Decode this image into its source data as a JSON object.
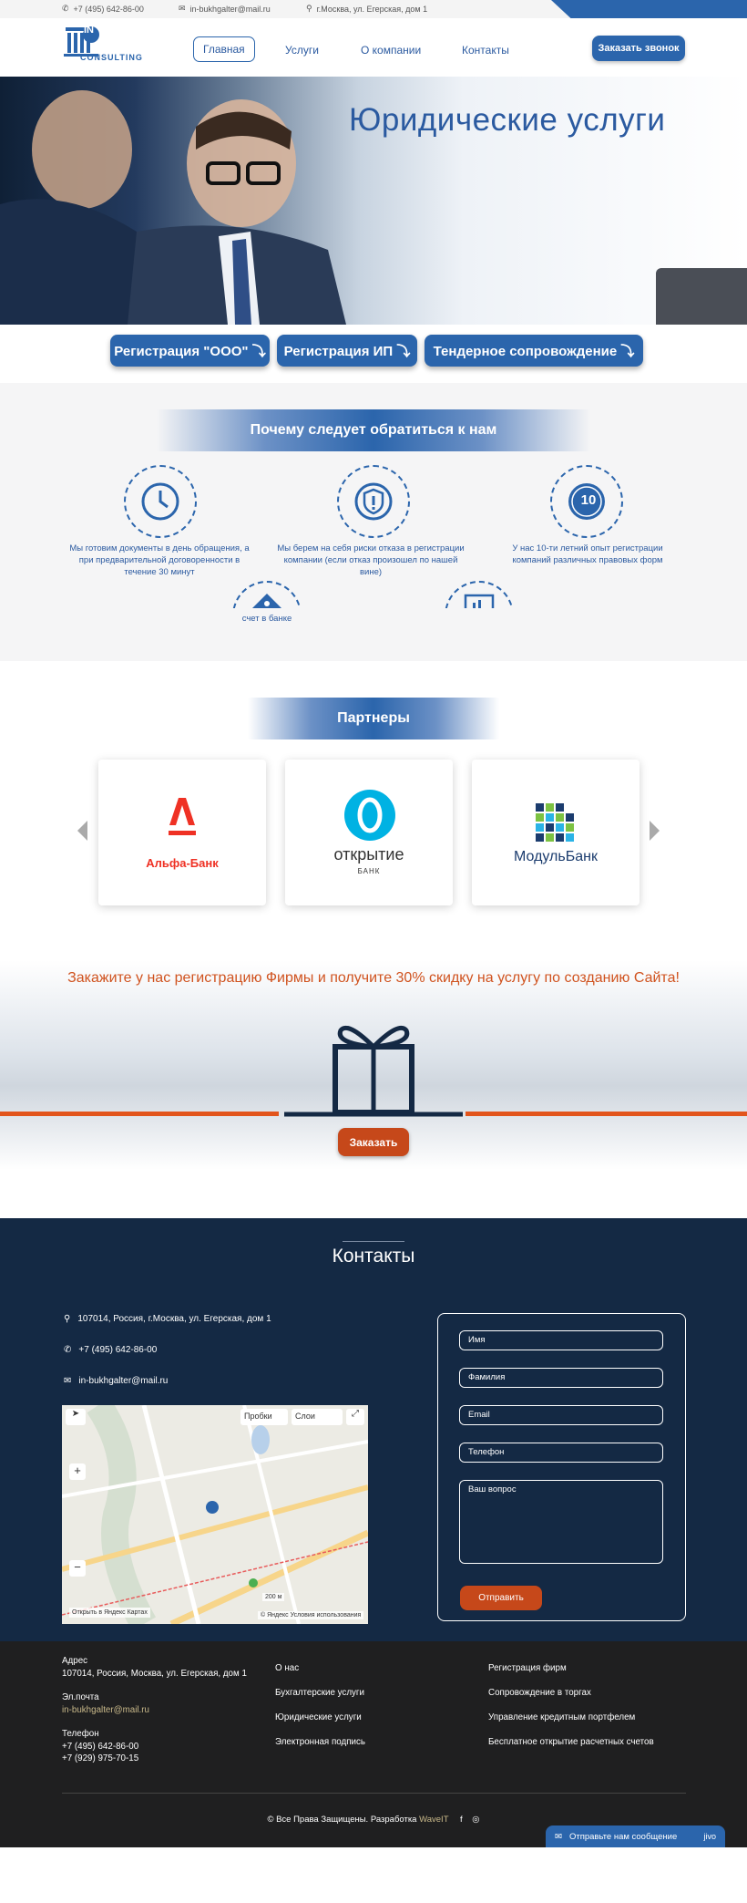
{
  "topbar": {
    "phone": "+7 (495) 642-86-00",
    "email": "in-bukhgalter@mail.ru",
    "address": "г.Москва, ул. Егерская, дом 1"
  },
  "logo": {
    "top_text": "IN",
    "bottom_text": "CONSULTING"
  },
  "nav": {
    "items": [
      "Главная",
      "Услуги",
      "О компании",
      "Контакты"
    ],
    "call_button": "Заказать звонок"
  },
  "hero": {
    "title": "Юридические услуги"
  },
  "services": {
    "buttons": [
      "Регистрация \"ООО\" ⤵",
      "Регистрация ИП ⤵",
      "Тендерное сопровождение ⤵"
    ]
  },
  "why": {
    "title": "Почему следует обратиться к нам",
    "items": [
      {
        "icon": "clock-icon",
        "text": "Мы готовим документы в день обращения, а при предварительной договоренности в течение 30 минут"
      },
      {
        "icon": "shield-icon",
        "text": "Мы берем на себя риски отказа в регистрации компании (если отказ произошел по нашей вине)"
      },
      {
        "icon": "badge-10-icon",
        "badge_text": "10",
        "text": "У нас 10-ти летний опыт регистрации компаний различных правовых форм"
      }
    ],
    "partial_caption": "счет в банке"
  },
  "partners": {
    "title": "Партнеры",
    "cards": [
      {
        "name": "Альфа-Банк",
        "logo": "alfa-logo",
        "color": "#ef3124"
      },
      {
        "name": "открытие",
        "sub": "БАНК",
        "logo": "otkritie-logo",
        "color": "#00b2e3"
      },
      {
        "name": "МодульБанк",
        "logo": "modulbank-logo",
        "color": "#1b3c6e"
      }
    ]
  },
  "promo": {
    "text": "Закажите у нас регистрацию Фирмы и получите 30% скидку на услугу по созданию Сайта!",
    "button": "Заказать",
    "accent": "#e2541b"
  },
  "contacts": {
    "title": "Контакты",
    "address": "107014, Россия, г.Москва, ул. Егерская, дом 1",
    "phone": "+7 (495) 642-86-00",
    "email": "in-bukhgalter@mail.ru",
    "map": {
      "traffic_label": "Пробки",
      "layers_label": "Слои",
      "open_label": "Открыть в Яндекс Картах",
      "copyright": "© Яндекс",
      "terms": "Условия использования",
      "scale": "200 м"
    },
    "form": {
      "name_placeholder": "Имя",
      "surname_placeholder": "Фамилия",
      "email_placeholder": "Email",
      "phone_placeholder": "Телефон",
      "question_placeholder": "Ваш вопрос",
      "submit": "Отправить"
    }
  },
  "footer": {
    "address_label": "Адрес",
    "address": "107014, Россия, Москва, ул. Егерская, дом 1",
    "email_label": "Эл.почта",
    "email": "in-bukhgalter@mail.ru",
    "phone_label": "Телефон",
    "phone1": "+7 (495) 642-86-00",
    "phone2": "+7 (929) 975-70-15",
    "col2": [
      "О нас",
      "Бухгалтерские услуги",
      "Юридические услуги",
      "Электронная подпись"
    ],
    "col3": [
      "Регистрация фирм",
      "Сопровождение в торгах",
      "Управление кредитным портфелем",
      "Бесплатное открытие расчетных счетов"
    ],
    "copyright_text": "© Все Права Защищены. Разработка",
    "dev": "WaveIT",
    "chat_label": "Отправьте нам сообщение",
    "chat_brand": "jivo"
  },
  "colors": {
    "primary": "#2b65ac",
    "dark": "#142944",
    "footer": "#1f1f20",
    "orange": "#c6481a"
  }
}
